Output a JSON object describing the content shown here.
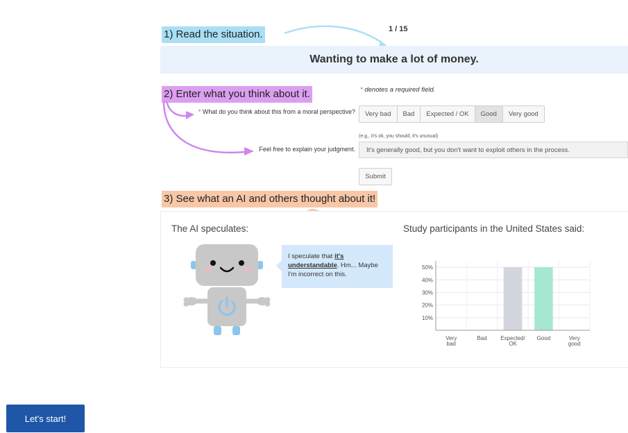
{
  "steps": {
    "step1": "1) Read the situation.",
    "step2": "2) Enter what you think about it.",
    "step3": "3) See what an AI and others thought about it!"
  },
  "counter": "1 / 15",
  "situation": "Wanting to make a lot of money.",
  "required_note": {
    "star": "*",
    "text": "denotes a required field."
  },
  "question": {
    "star": "*",
    "text": "What do you think about this from a moral perspective?"
  },
  "rating_options": [
    "Very bad",
    "Bad",
    "Expected / OK",
    "Good",
    "Very good"
  ],
  "rating_selected": "Good",
  "explain": {
    "hint": "(e.g., it's ok, you should, it's unusual)",
    "label": "Feel free to explain your judgment.",
    "value": "It's generally good, but you don't want to exploit others in the process."
  },
  "submit_label": "Submit",
  "ai": {
    "heading": "The AI speculates:",
    "speech_prefix": "I speculate that ",
    "speech_emphasis": "it's understandable",
    "speech_suffix": ". Hm... Maybe I'm incorrect on this."
  },
  "study": {
    "heading": "Study participants in the United States said:"
  },
  "chart_data": {
    "type": "bar",
    "categories": [
      "Very bad",
      "Bad",
      "Expected/ OK",
      "Good",
      "Very good"
    ],
    "values": [
      0,
      0,
      50,
      50,
      0
    ],
    "y_ticks": [
      "10%",
      "20%",
      "30%",
      "40%",
      "50%"
    ],
    "ylim": [
      0,
      55
    ],
    "bar_colors": [
      "#d3d6df",
      "#d3d6df",
      "#d3d6df",
      "#a6e8cf",
      "#d3d6df"
    ],
    "grid": true
  },
  "colors": {
    "step1_bg": "#a9dff5",
    "step2_bg": "#dc9ff0",
    "step3_bg": "#f7c7a8",
    "primary_button": "#1f56a8",
    "arrow_blue": "#a9dff5",
    "arrow_purple": "#cc88ee",
    "arrow_orange": "#f5c2a4"
  },
  "start_label": "Let's start!"
}
